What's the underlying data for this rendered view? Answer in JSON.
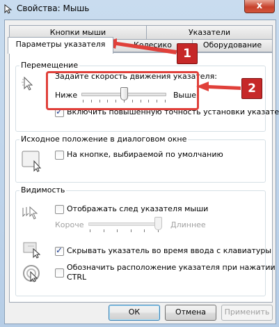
{
  "window": {
    "title": "Свойства: Мышь",
    "close_glyph": "x"
  },
  "tabs": {
    "row_back": [
      "Кнопки мыши",
      "Указатели"
    ],
    "row_front": [
      "Параметры указателя",
      "Колесико",
      "Оборудование"
    ],
    "active": "Параметры указателя"
  },
  "motion": {
    "legend": "Перемещение",
    "speed_label": "Задайте скорость движения указателя:",
    "slow_label": "Ниже",
    "fast_label": "Выше",
    "speed_level": 0.5,
    "precision_label": "Включить повышенную точность установки указателя",
    "precision_checked": true
  },
  "snap": {
    "legend": "Исходное положение в диалоговом окне",
    "label": "На кнопке, выбираемой по умолчанию",
    "checked": false
  },
  "visibility": {
    "legend": "Видимость",
    "trails_label": "Отображать след указателя мыши",
    "trails_checked": false,
    "short_label": "Короче",
    "long_label": "Длиннее",
    "trail_level": 1.0,
    "hide_label": "Скрывать указатель во время ввода с клавиатуры",
    "hide_checked": true,
    "ctrl_label_line1": "Обозначить расположение указателя при нажатии",
    "ctrl_label_line2": "CTRL",
    "ctrl_checked": false
  },
  "buttons": {
    "ok": "ОК",
    "cancel": "Отмена",
    "apply": "Применить"
  },
  "annotations": {
    "badge1": "1",
    "badge2": "2",
    "color": "#e0403a"
  }
}
